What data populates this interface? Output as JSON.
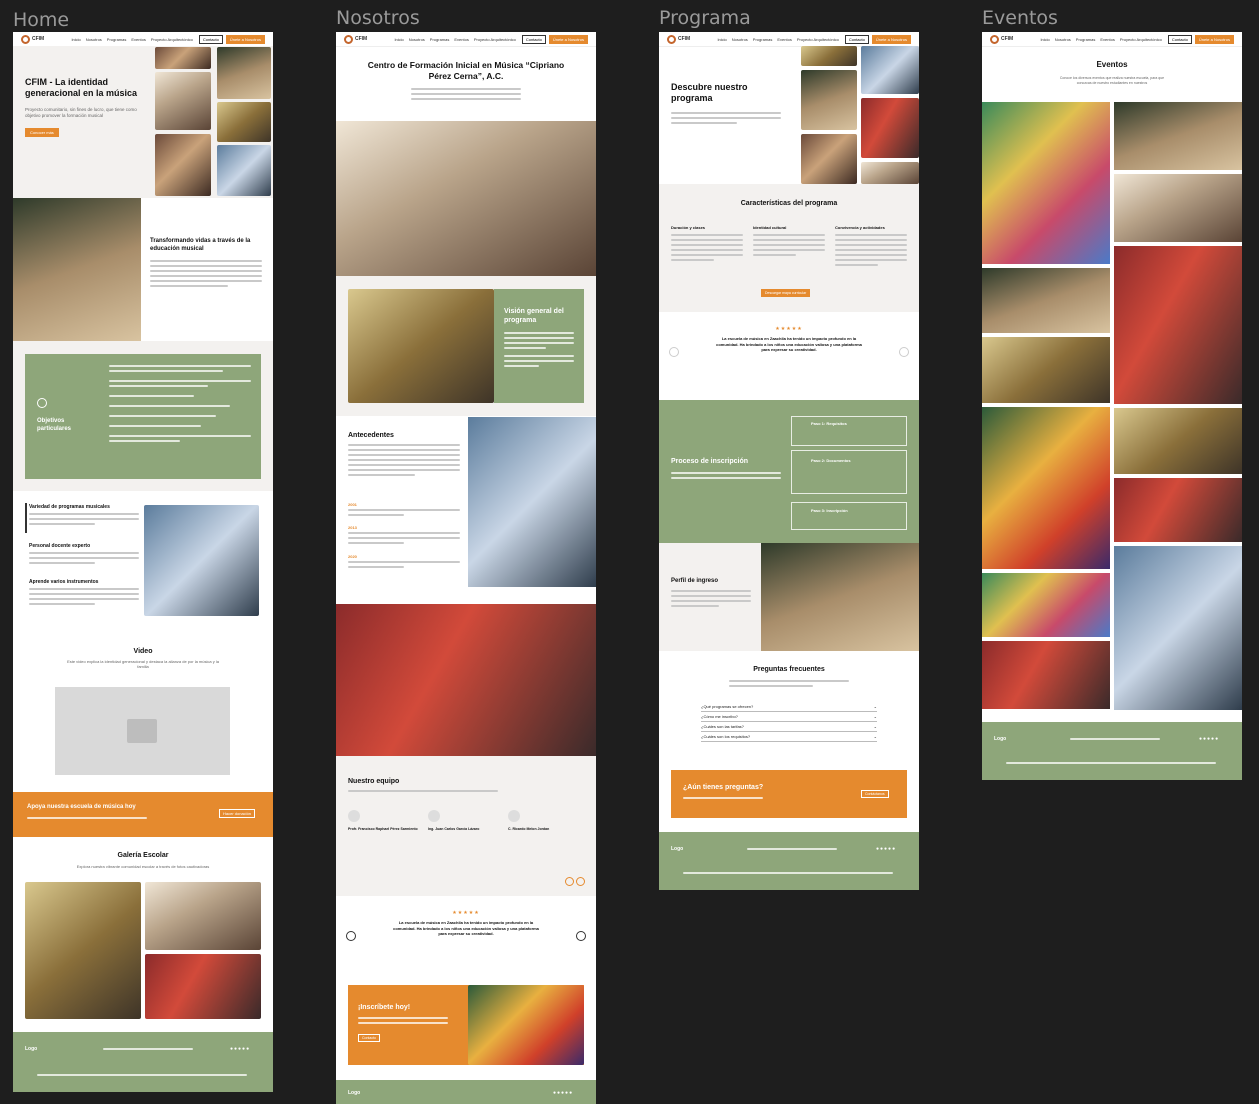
{
  "frames": {
    "home": "Home",
    "nosotros": "Nosotros",
    "programa": "Programa",
    "eventos": "Eventos"
  },
  "nav": {
    "logo": "CFIM",
    "links": [
      "Inicio",
      "Nosotros",
      "Programas",
      "Eventos",
      "Proyecto Arquitectónico"
    ],
    "contact": "Contacto",
    "cta": "Únete a Nosotros"
  },
  "home": {
    "hero_title": "CFIM - La identidad generacional en la música",
    "hero_text": "Proyecto comunitario, sin fines de lucro, que tiene como objetivo promover la formación musical",
    "hero_btn": "Conocer más",
    "transform_title": "Transformando vidas a través de la educación musical",
    "objetivos_title": "Objetivos particulares",
    "feat1_title": "Variedad de programas musicales",
    "feat2_title": "Personal docente experto",
    "feat3_title": "Aprende varios instrumentos",
    "video_title": "Video",
    "video_text": "Este video explica la identidad generacional y destaca la alianza de por la música y la familia",
    "support_title": "Apoya nuestra escuela de música hoy",
    "support_btn": "Hacer donación",
    "gallery_title": "Galería Escolar",
    "gallery_text": "Explora nuestra vibrante comunidad escolar a través de fotos cautivadoras",
    "footer_logo": "Logo"
  },
  "nosotros": {
    "hero_title": "Centro de Formación Inicial en Música “Cipriano Pérez Cerna”, A.C.",
    "vision_title": "Visión general del programa",
    "antecedentes_title": "Antecedentes",
    "year1": "2001",
    "year2": "2013",
    "year3": "2020",
    "equipo_title": "Nuestro equipo",
    "team1": "Profr. Francisco Raphael Pérez Sarmiento",
    "team2": "Ing. Juan Carlos García Lázaro",
    "team3": "C. Ricardo Melon Jordan",
    "quote": "La escuela de música en Zaachila ha tenido un impacto profundo en la comunidad. Ha brindado a los niños una educación valiosa y una plataforma para expresar su creatividad.",
    "inscribete_title": "¡Inscríbete hoy!",
    "inscribete_btn": "Contacto",
    "footer_logo": "Logo"
  },
  "programa": {
    "hero_title": "Descubre nuestro programa",
    "caracteristicas_title": "Características del programa",
    "col1": "Duración y clases",
    "col2": "Identidad cultural",
    "col3": "Convivencia y actividades",
    "cta": "Descargar mapa curricular",
    "quote": "La escuela de música en Zaachila ha tenido un impacto profundo en la comunidad. Ha brindado a los niños una educación valiosa y una plataforma para expresar su creatividad.",
    "proceso_title": "Proceso de inscripción",
    "paso1": "Paso 1: Requisitos",
    "paso2": "Paso 2: Documentos",
    "paso3": "Paso 3: Inscripción",
    "perfil_title": "Perfil de ingreso",
    "faq_title": "Preguntas frecuentes",
    "faq": [
      "¿Qué programas se ofrecen?",
      "¿Cómo me inscribo?",
      "¿Cuáles son las tarifas?",
      "¿Cuáles son los requisitos?"
    ],
    "aun_title": "¿Aún tienes preguntas?",
    "aun_btn": "Contáctanos",
    "footer_logo": "Logo"
  },
  "eventos": {
    "title": "Eventos",
    "text": "Conoce los diversos eventos que realiza nuestra escuela, para que conozcas de nuestro estudiantes en nuestros",
    "footer_logo": "Logo"
  }
}
